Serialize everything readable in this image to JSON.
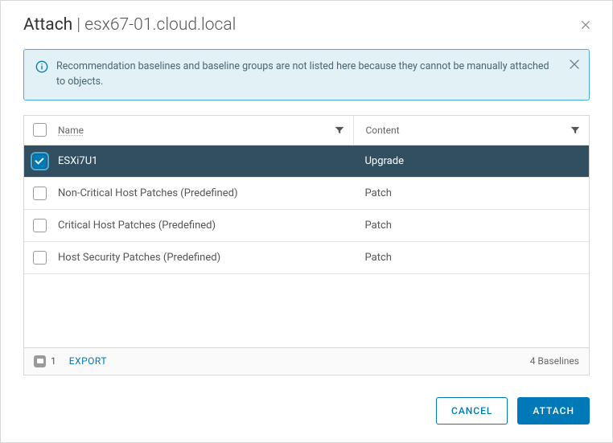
{
  "header": {
    "title_prefix": "Attach",
    "title_sep": " | ",
    "title_target": "esx67-01.cloud.local"
  },
  "banner": {
    "text": "Recommendation baselines and baseline groups are not listed here because they cannot be manually attached to objects."
  },
  "table": {
    "columns": {
      "name": "Name",
      "content": "Content"
    },
    "rows": [
      {
        "name": "ESXi7U1",
        "content": "Upgrade",
        "checked": true
      },
      {
        "name": "Non-Critical Host Patches (Predefined)",
        "content": "Patch",
        "checked": false
      },
      {
        "name": "Critical Host Patches (Predefined)",
        "content": "Patch",
        "checked": false
      },
      {
        "name": "Host Security Patches (Predefined)",
        "content": "Patch",
        "checked": false
      }
    ],
    "footer": {
      "selected_count": "1",
      "export_label": "EXPORT",
      "total_label": "4 Baselines"
    }
  },
  "buttons": {
    "cancel": "CANCEL",
    "attach": "ATTACH"
  }
}
